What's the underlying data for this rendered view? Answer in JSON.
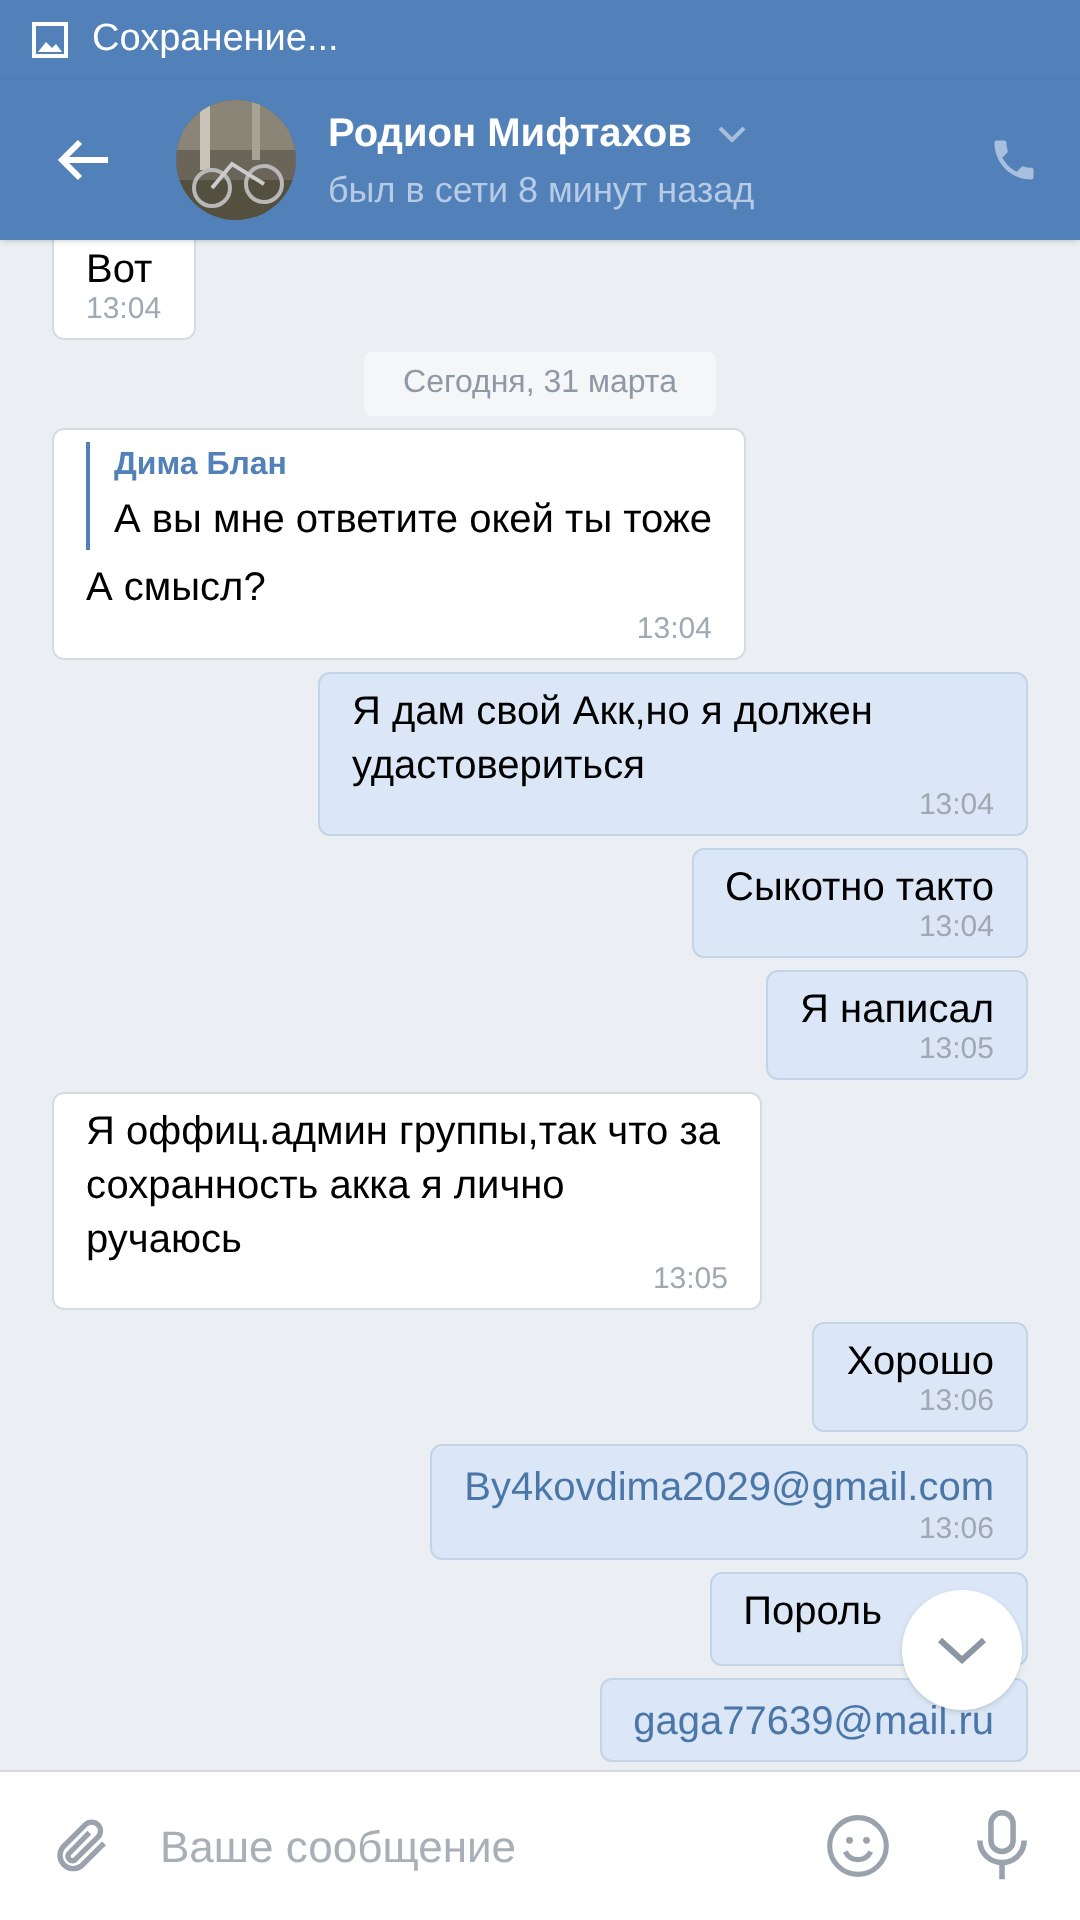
{
  "status_bar": {
    "text": "Сохранение..."
  },
  "header": {
    "name": "Родион Мифтахов",
    "status": "был в сети 8 минут назад"
  },
  "date_badge": "Сегодня, 31 марта",
  "messages": [
    {
      "kind": "text",
      "outgoing": false,
      "text": "Вот",
      "time": "13:04"
    },
    {
      "kind": "reply",
      "outgoing": false,
      "quote_author": "Дима Блан",
      "quote_text": "А вы мне ответите окей ты тоже",
      "text": "А смысл?",
      "time": "13:04"
    },
    {
      "kind": "text",
      "outgoing": true,
      "text": "Я дам свой Акк,но я должен удастовериться",
      "time": "13:04"
    },
    {
      "kind": "text",
      "outgoing": true,
      "text": "Сыкотно такто",
      "time": "13:04"
    },
    {
      "kind": "text",
      "outgoing": true,
      "text": "Я написал",
      "time": "13:05"
    },
    {
      "kind": "text",
      "outgoing": false,
      "text": "Я оффиц.админ группы,так что за сохранность акка я лично ручаюсь",
      "time": "13:05"
    },
    {
      "kind": "text",
      "outgoing": true,
      "text": "Хорошо",
      "time": "13:06"
    },
    {
      "kind": "link",
      "outgoing": true,
      "text": "By4kovdima2029@gmail.com",
      "time": "13:06"
    },
    {
      "kind": "text",
      "outgoing": true,
      "text": "Пороль"
    },
    {
      "kind": "link",
      "outgoing": true,
      "text": "gaga77639@mail.ru"
    }
  ],
  "composer": {
    "placeholder": "Ваше сообщение"
  }
}
